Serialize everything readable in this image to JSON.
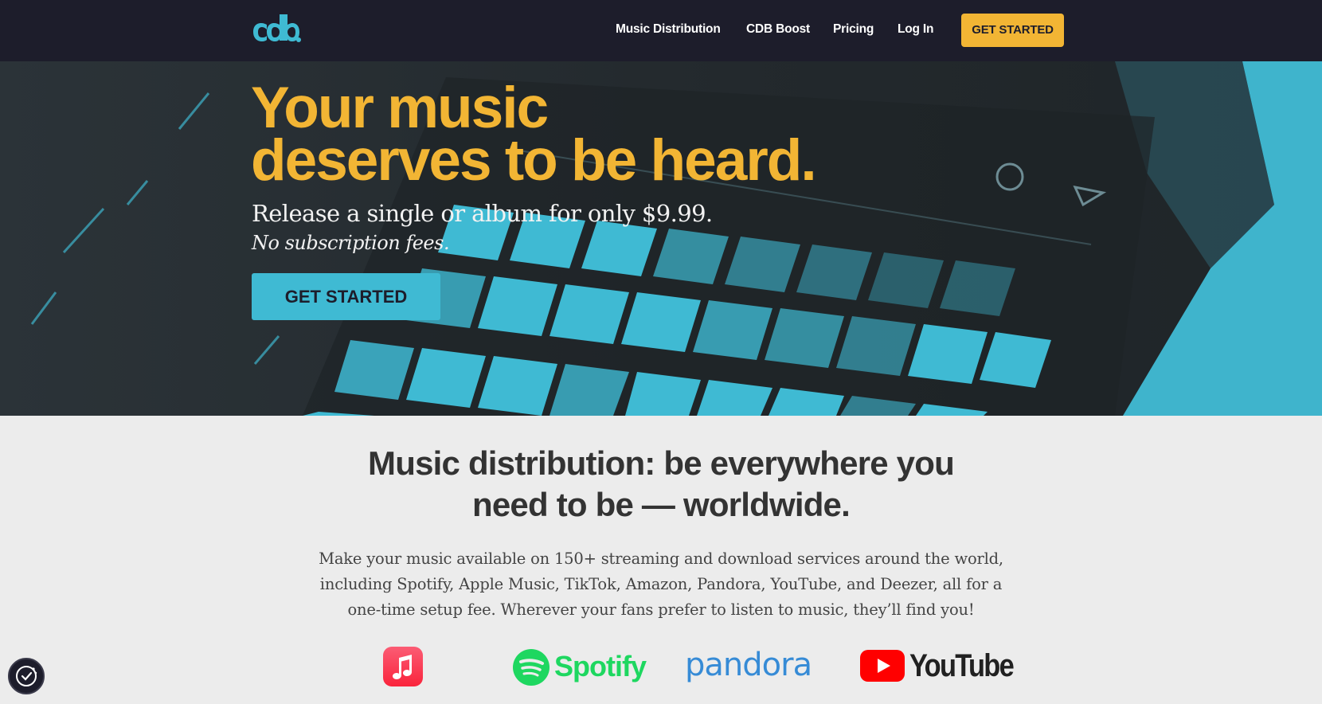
{
  "nav": {
    "logo_icon": "cdbaby-logo-icon",
    "items": [
      {
        "label": "Music Distribution"
      },
      {
        "label": "CDB Boost"
      },
      {
        "label": "Pricing"
      },
      {
        "label": "Log In"
      }
    ],
    "cta_label": "GET STARTED"
  },
  "hero": {
    "title_line1": "Your music",
    "title_line2": "deserves to be heard.",
    "subtitle": "Release a single or album for only $9.99.",
    "subtitle2": "No subscription fees.",
    "cta_label": "GET STARTED",
    "background": "launchpad-grid-photo"
  },
  "section": {
    "title_line1": "Music distribution: be everywhere you",
    "title_line2": "need to be — worldwide.",
    "body": "Make your music available on 150+ streaming and download services around the world, including Spotify, Apple Music, TikTok, Amazon, Pandora, YouTube, and Deezer, all for a one-time setup fee. Wherever your fans prefer to listen to music, they’ll find you!",
    "brands": {
      "spotify": "Spotify",
      "pandora": "pandora",
      "youtube": "YouTube"
    }
  },
  "colors": {
    "nav_bg": "#1d1d2b",
    "accent_yellow": "#f2b534",
    "accent_teal": "#3fbad3",
    "section_bg": "#ececec"
  },
  "consent_icon": "cookie-consent-icon"
}
